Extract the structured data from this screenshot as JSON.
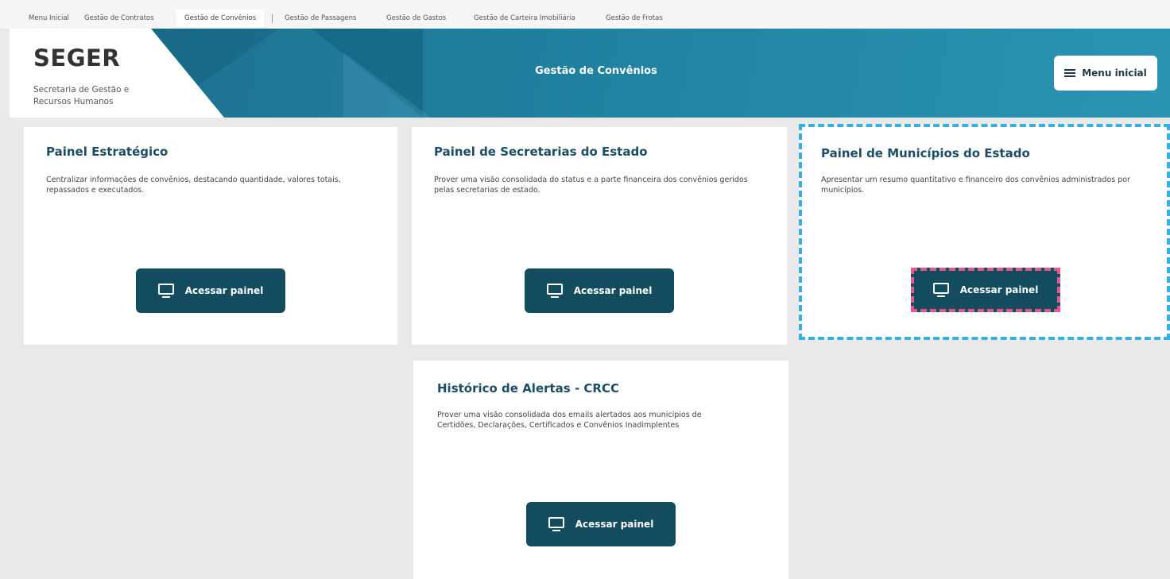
{
  "tabs": [
    {
      "label": "Menu Inicial",
      "active": false
    },
    {
      "label": "Gestão de Contratos",
      "active": false
    },
    {
      "label": "Gestão de Convênios",
      "active": true
    },
    {
      "label": "Gestão de Passagens",
      "active": false
    },
    {
      "label": "Gestão de Gastos",
      "active": false
    },
    {
      "label": "Gestão de Carteira Imobiliária",
      "active": false
    },
    {
      "label": "Gestão de Frotas",
      "active": false
    }
  ],
  "header": {
    "logo_title": "SEGER",
    "logo_subtitle": "Secretaria de Gestão e Recursos Humanos",
    "title": "Gestão de Convênios",
    "menu_button": "Menu inicial"
  },
  "cards": [
    {
      "title": "Painel Estratégico",
      "description": "Centralizar informações de convênios, destacando quantidade, valores totais, repassados e executados.",
      "button": "Acessar painel"
    },
    {
      "title": "Painel de Secretarias do Estado",
      "description": "Prover uma visão consolidada do status e a parte financeira dos convênios geridos pelas secretarias de estado.",
      "button": "Acessar painel"
    },
    {
      "title": "Painel de Municípios do Estado",
      "description": "Apresentar um resumo quantitativo e financeiro dos convênios administrados por municípios.",
      "button": "Acessar painel"
    },
    {
      "title": "Histórico de Alertas - CRCC",
      "description": "Prover uma visão consolidada dos emails alertados aos municípios de Certidões, Declarações, Certificados e Convênios Inadimplentes",
      "button": "Acessar painel"
    }
  ],
  "colors": {
    "header_bg": "#1f7d9c",
    "button_bg": "#134b5f",
    "card_title": "#1b4d63",
    "highlight_card": "#35b0e0",
    "highlight_button": "#e8578c"
  },
  "icons": {
    "menu": "hamburger-icon",
    "button": "monitor-icon"
  }
}
